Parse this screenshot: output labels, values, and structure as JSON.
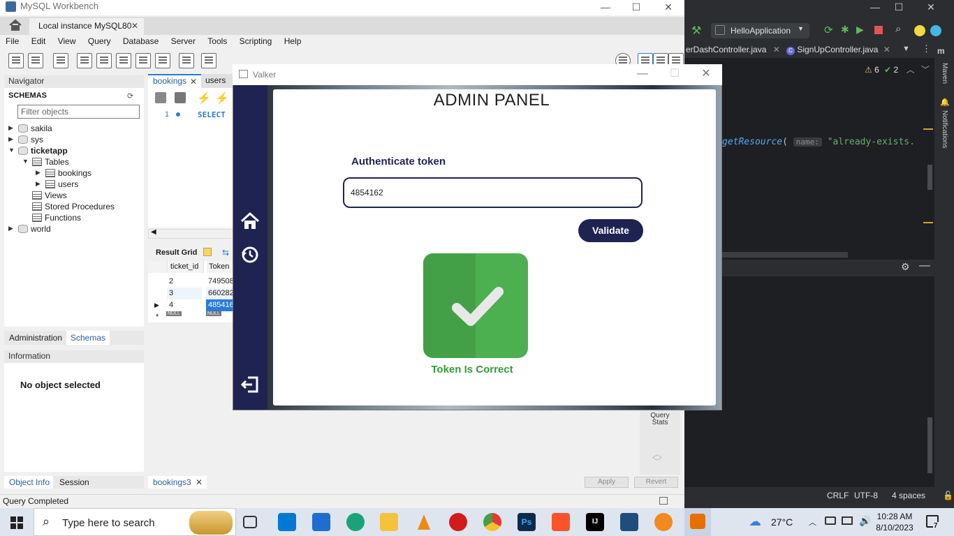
{
  "workbench": {
    "window_title": "MySQL Workbench",
    "instance_tab": "Local instance MySQL80",
    "menu": [
      "File",
      "Edit",
      "View",
      "Query",
      "Database",
      "Server",
      "Tools",
      "Scripting",
      "Help"
    ],
    "navigator_label": "Navigator",
    "schemas_label": "SCHEMAS",
    "filter_placeholder": "Filter objects",
    "tree": {
      "sakila": "sakila",
      "sys": "sys",
      "ticketapp": "ticketapp",
      "tables": "Tables",
      "bookings": "bookings",
      "users": "users",
      "views": "Views",
      "stored_procedures": "Stored Procedures",
      "functions": "Functions",
      "world": "world"
    },
    "left_tabs": {
      "administration": "Administration",
      "schemas": "Schemas"
    },
    "information_label": "Information",
    "no_object": "No object selected",
    "bottom_tabs": {
      "object_info": "Object Info",
      "session": "Session"
    },
    "status": "Query Completed",
    "query_tabs": {
      "bookings": "bookings",
      "users": "users"
    },
    "editor": {
      "line": "1",
      "keyword": "SELECT"
    },
    "result_grid_label": "Result Grid",
    "grid": {
      "headers": [
        "ticket_id",
        "Token"
      ],
      "rows": [
        [
          "2",
          "749508"
        ],
        [
          "3",
          "660282"
        ],
        [
          "4",
          "485416"
        ]
      ],
      "null_label": "NULL"
    },
    "query_stats": "Query Stats",
    "result_tab": "bookings3",
    "apply": "Apply",
    "revert": "Revert"
  },
  "ide": {
    "run_config": "HelloApplication",
    "tabs": [
      "erDashController.java",
      "SignUpController.java"
    ],
    "warnings": "6",
    "weak_warnings": "2",
    "code": {
      "fn": "getResource",
      "param": "name:",
      "str": "\"already-exists."
    },
    "status": {
      "line_sep": "CRLF",
      "encoding": "UTF-8",
      "indent": "4 spaces"
    },
    "side_labels": {
      "maven": "Maven",
      "notifications": "Notifications"
    }
  },
  "valker": {
    "window_title": "Valker",
    "heading": "ADMIN PANEL",
    "auth_label": "Authenticate token",
    "token_value": "4854162",
    "validate_label": "Validate",
    "result_message": "Token Is Correct",
    "colors": {
      "primary": "#1f2352",
      "success": "#2e9e35"
    }
  },
  "taskbar": {
    "search_placeholder": "Type here to search",
    "temperature": "27°C",
    "time": "10:28 AM",
    "date": "8/10/2023",
    "notifications_count": "7"
  }
}
